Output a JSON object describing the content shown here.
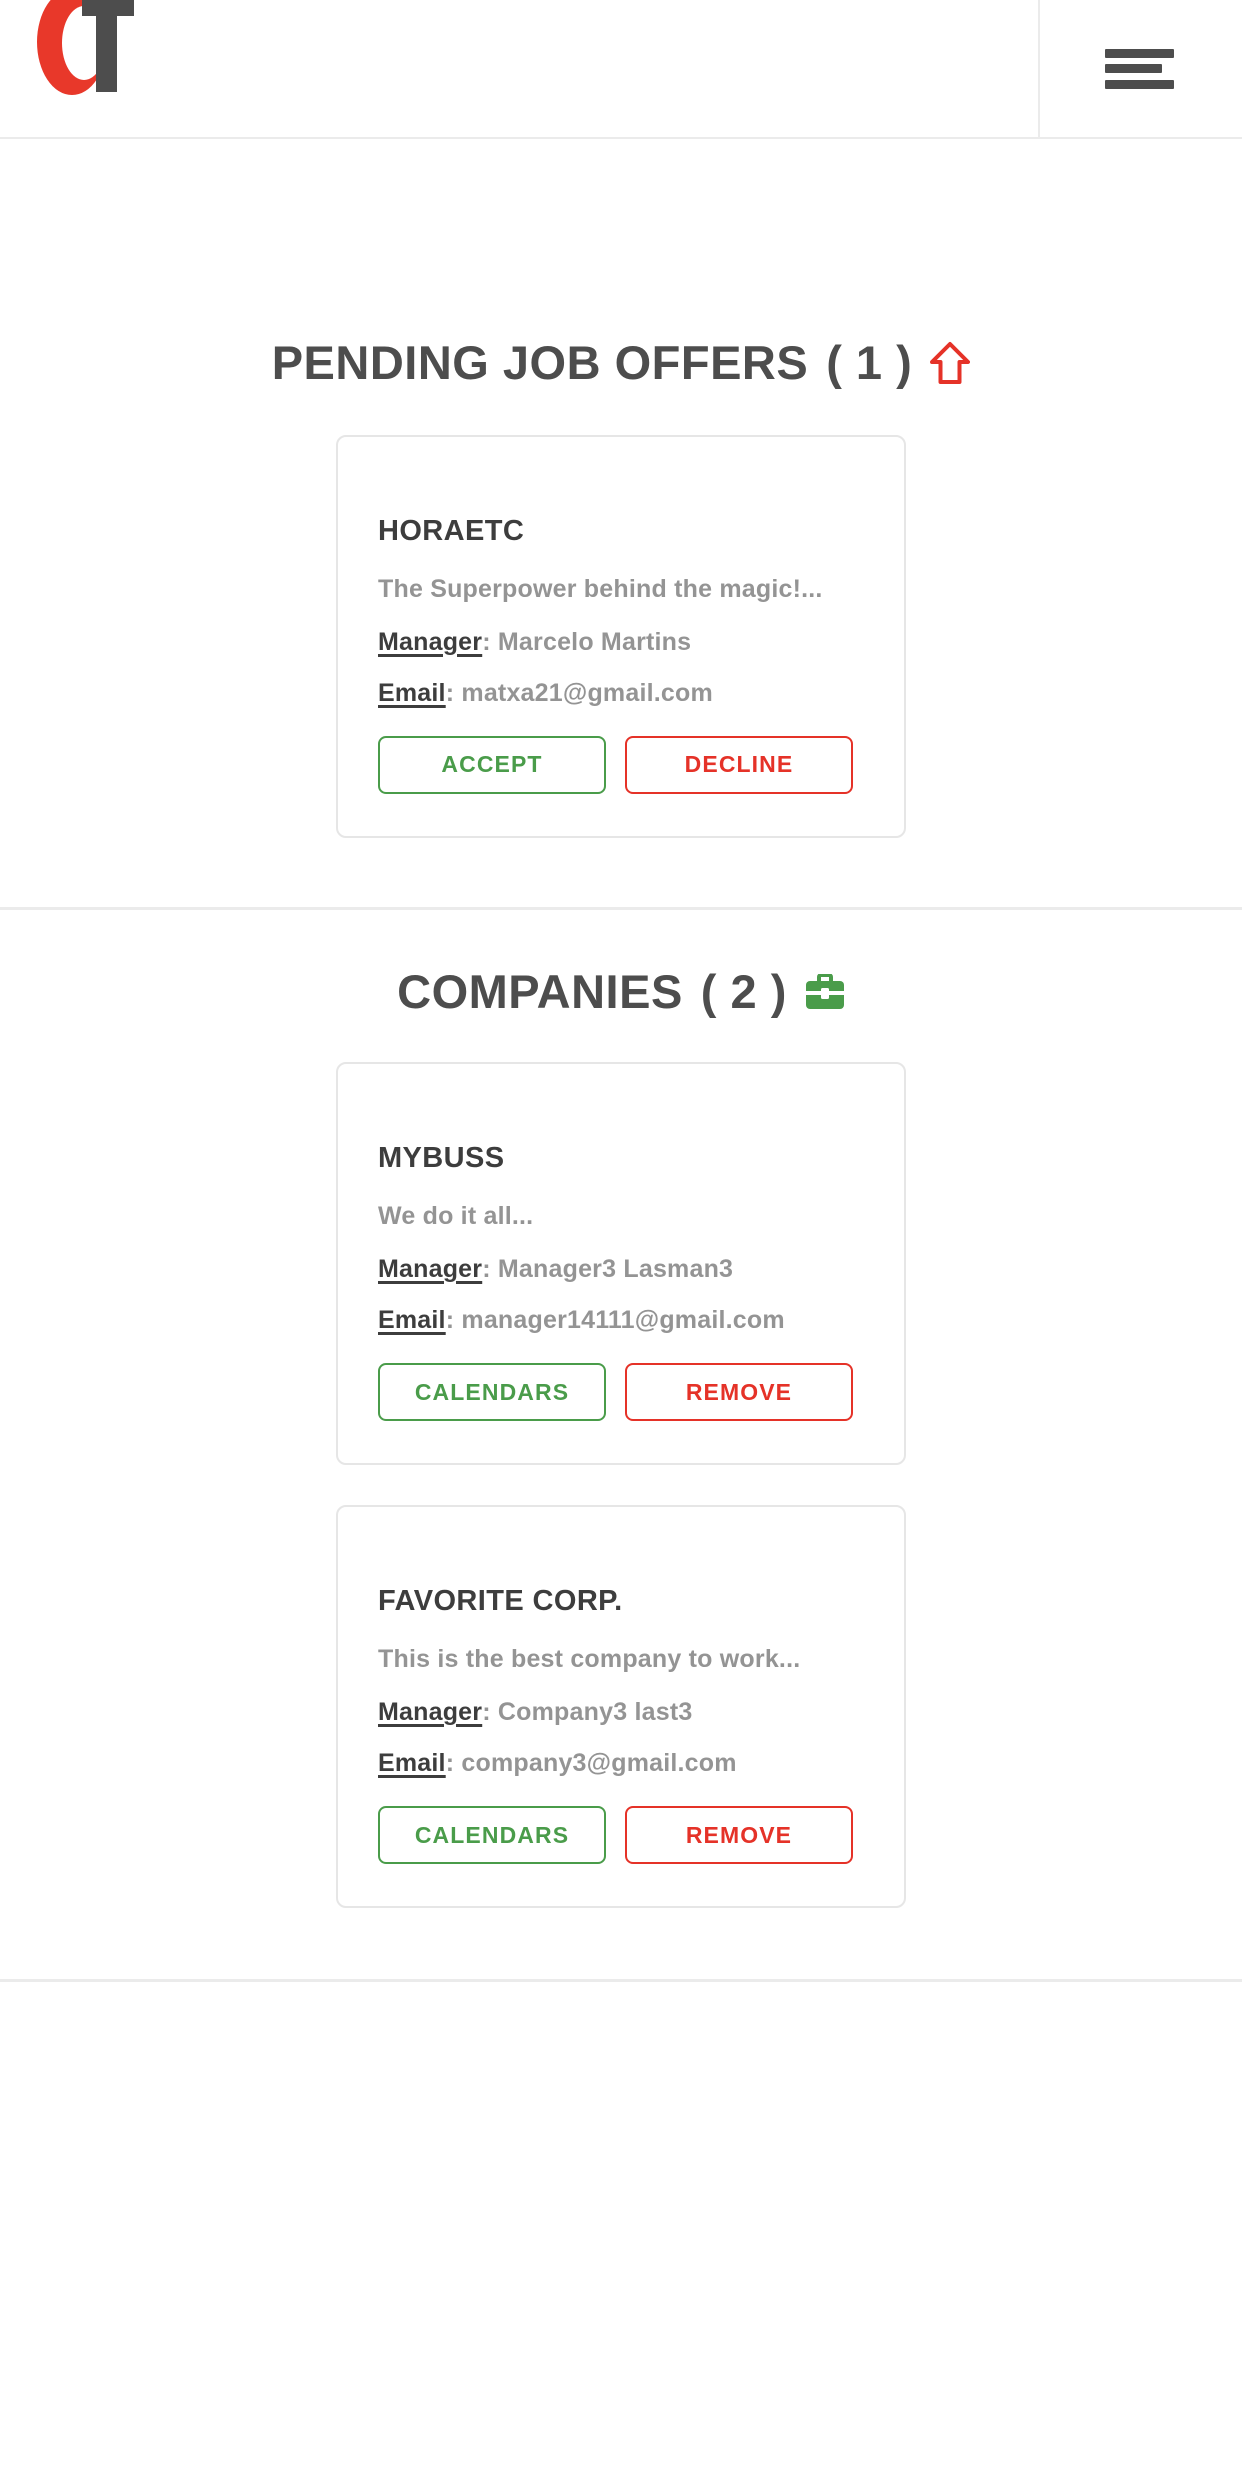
{
  "header": {
    "logo_text_primary": "C",
    "logo_text_secondary": "T",
    "logo_name": "CT",
    "menu_label": "Menu"
  },
  "colors": {
    "brand_red": "#e53228",
    "logo_red": "#e8382a",
    "accent_green": "#4a9c4a",
    "heading_gray": "#4d4d4d",
    "body_gray": "#949494",
    "card_border": "#e6e6e6",
    "divider": "#ebebeb"
  },
  "sections": [
    {
      "id": "pending-job-offers",
      "title": "PENDING JOB OFFERS",
      "count_text": "( 1 )",
      "icon": "arrow-up-icon",
      "cards": [
        {
          "name": "HORAETC",
          "tagline": "The Superpower behind the magic!...",
          "manager_label": "Manager",
          "manager_separator": ":",
          "manager_value": "Marcelo Martins",
          "email_label": "Email",
          "email_separator": ":",
          "email_value": "matxa21@gmail.com",
          "primary_action": "ACCEPT",
          "secondary_action": "DECLINE"
        }
      ]
    },
    {
      "id": "companies",
      "title": "COMPANIES",
      "count_text": "( 2 )",
      "icon": "briefcase-icon",
      "cards": [
        {
          "name": "MYBUSS",
          "tagline": "We do it all...",
          "manager_label": "Manager",
          "manager_separator": ":",
          "manager_value": "Manager3 Lasman3",
          "email_label": "Email",
          "email_separator": ":",
          "email_value": "manager14111@gmail.com",
          "primary_action": "CALENDARS",
          "secondary_action": "REMOVE"
        },
        {
          "name": "FAVORITE CORP.",
          "tagline": "This is the best company to work...",
          "manager_label": "Manager",
          "manager_separator": ":",
          "manager_value": "Company3 last3",
          "email_label": "Email",
          "email_separator": ":",
          "email_value": "company3@gmail.com",
          "primary_action": "CALENDARS",
          "secondary_action": "REMOVE"
        }
      ]
    }
  ]
}
